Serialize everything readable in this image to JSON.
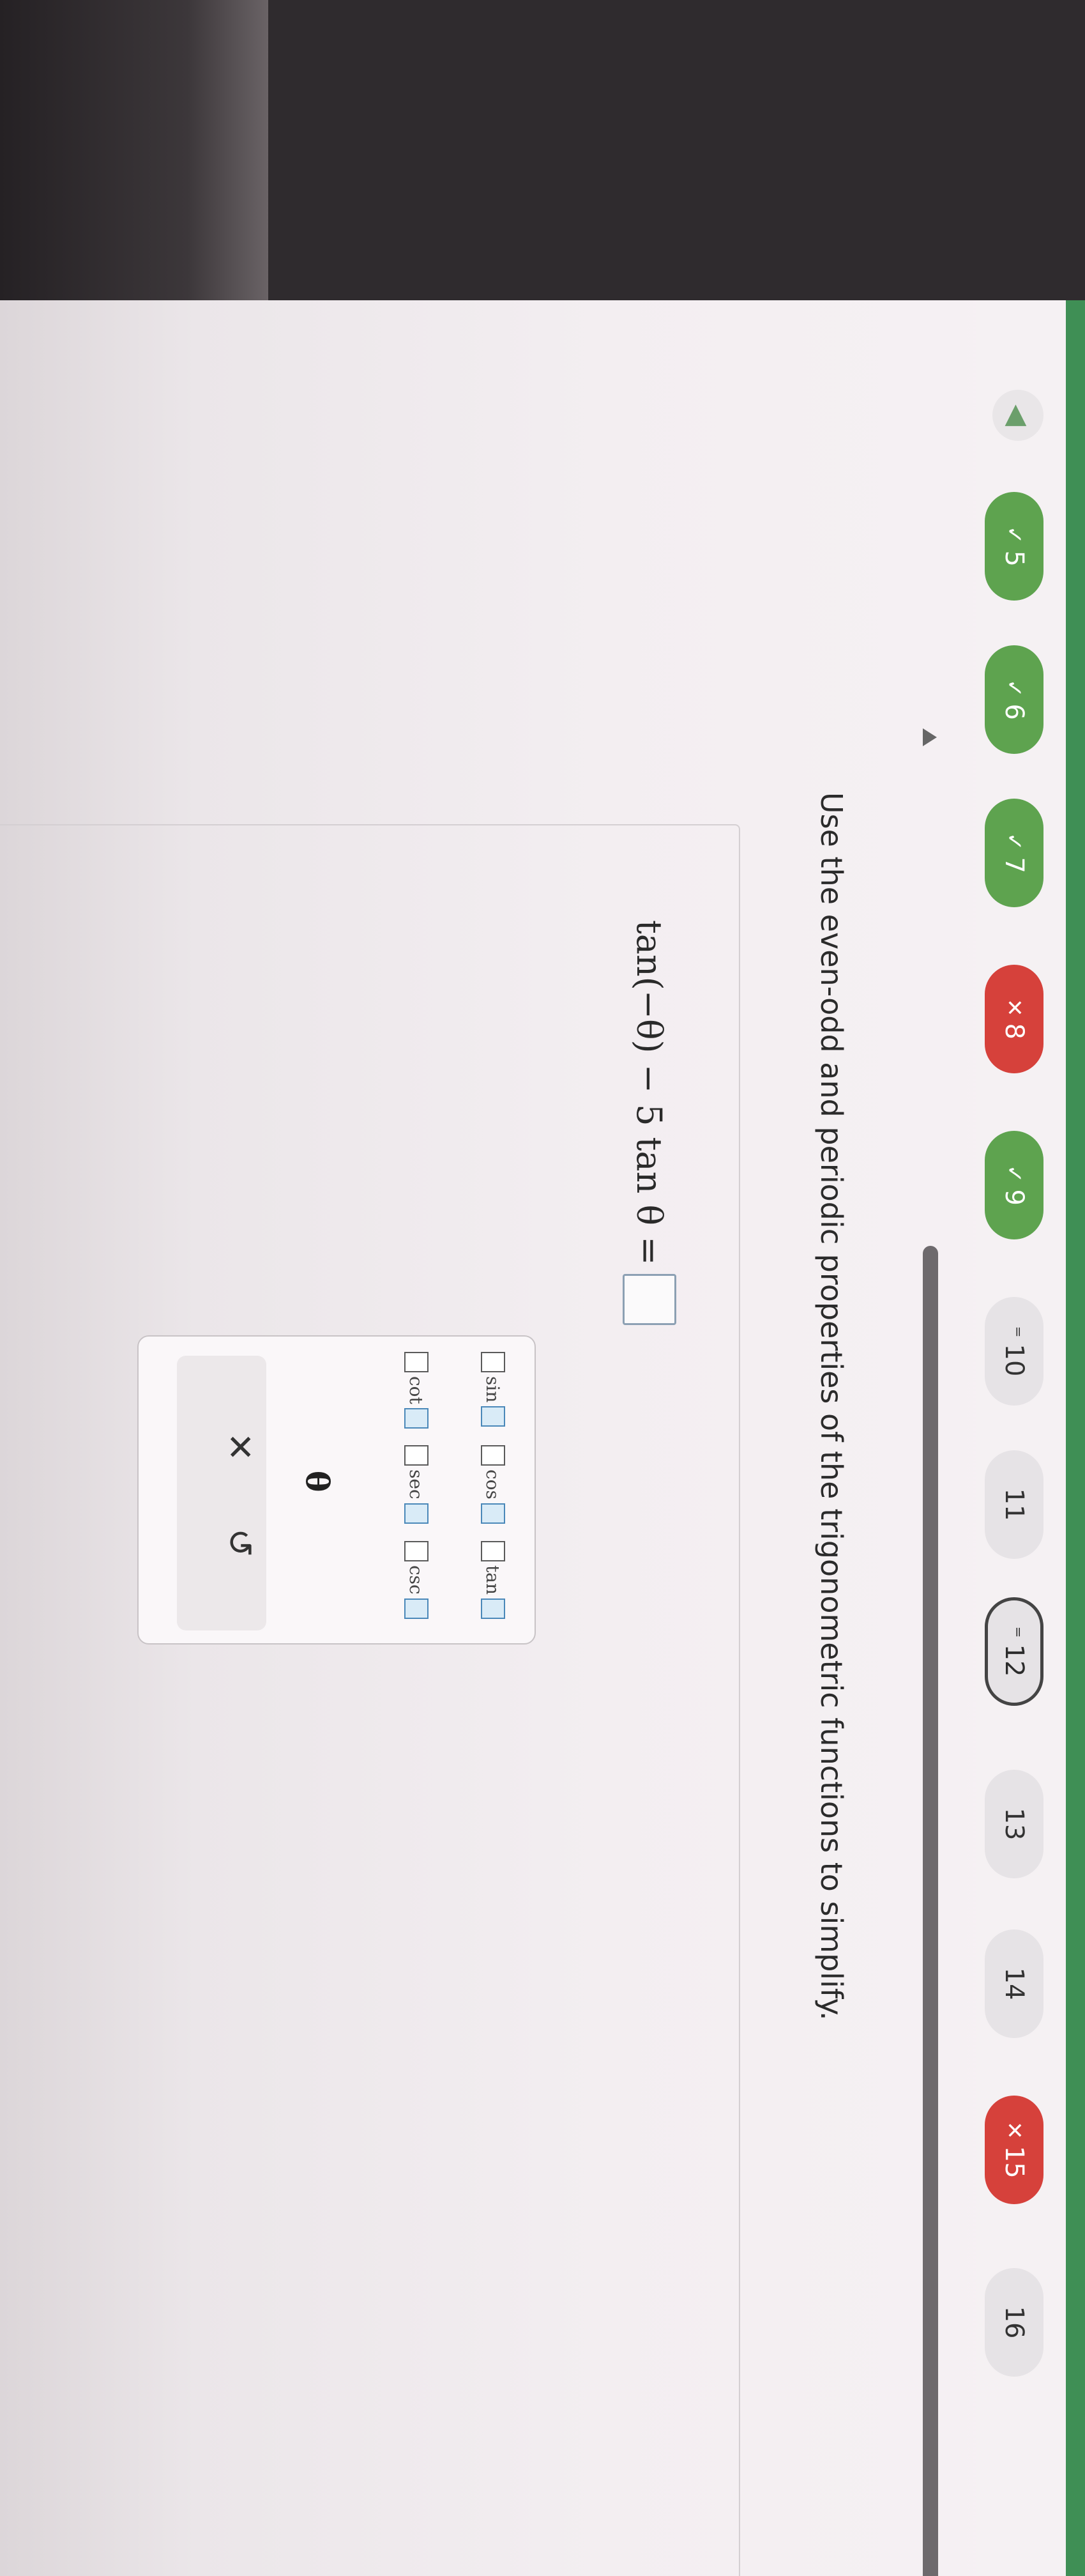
{
  "nav": {
    "back_icon": "triangle-left",
    "questions": [
      {
        "label": "5",
        "mark": "✓",
        "status": "correct"
      },
      {
        "label": "6",
        "mark": "✓",
        "status": "correct"
      },
      {
        "label": "7",
        "mark": "✓",
        "status": "correct"
      },
      {
        "label": "8",
        "mark": "✕",
        "status": "wrong"
      },
      {
        "label": "9",
        "mark": "✓",
        "status": "correct"
      },
      {
        "label": "10",
        "mark": "⁼",
        "status": "partial"
      },
      {
        "label": "11",
        "mark": "",
        "status": "unanswered"
      },
      {
        "label": "12",
        "mark": "⁼",
        "status": "current"
      },
      {
        "label": "13",
        "mark": "",
        "status": "unanswered"
      },
      {
        "label": "14",
        "mark": "",
        "status": "unanswered"
      },
      {
        "label": "15",
        "mark": "✕",
        "status": "wrong"
      },
      {
        "label": "16",
        "mark": "",
        "status": "unanswered"
      }
    ]
  },
  "question": {
    "text": "Use the even-odd and periodic properties of the trigonometric functions to simplify."
  },
  "equation": {
    "left_side": "tan(−θ) − 5 tan θ ="
  },
  "palette": {
    "functions": [
      {
        "name": "sin"
      },
      {
        "name": "cos"
      },
      {
        "name": "tan"
      },
      {
        "name": "cot"
      },
      {
        "name": "sec"
      },
      {
        "name": "csc"
      }
    ],
    "theta": "θ",
    "clear_symbol": "✕",
    "undo_symbol": "↺"
  },
  "colors": {
    "correct": "#5ea34f",
    "wrong": "#d6413b",
    "accent_box": "#4a88b9"
  }
}
